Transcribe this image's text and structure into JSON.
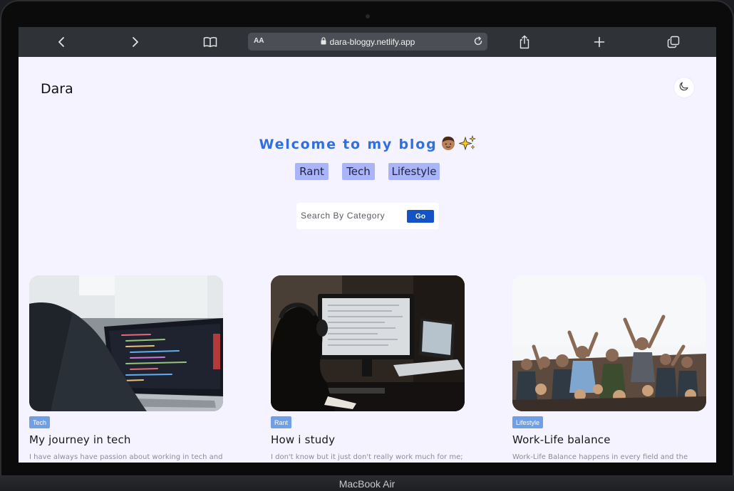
{
  "device": {
    "label": "MacBook Air"
  },
  "browser": {
    "text_size_label": "AA",
    "url": "dara-bloggy.netlify.app",
    "icons": [
      "back-icon",
      "forward-icon",
      "bookmarks-icon",
      "lock-icon",
      "reload-icon",
      "share-icon",
      "new-tab-icon",
      "tabs-icon"
    ]
  },
  "site": {
    "brand": "Dara",
    "theme_toggle_icon": "moon-icon",
    "welcome": "Welcome to my blog",
    "welcome_emojis": [
      "boy-emoji",
      "sparkles-emoji"
    ],
    "categories": [
      "Rant",
      "Tech",
      "Lifestyle"
    ],
    "search": {
      "placeholder": "Search By Category",
      "button": "Go"
    },
    "accent": "#2f6fe0",
    "tag_color": "#a9b5f8"
  },
  "posts": [
    {
      "category": "Tech",
      "title": "My journey in tech",
      "excerpt": "I have always have passion about working in tech and",
      "image": "person-coding-on-laptop-photo"
    },
    {
      "category": "Rant",
      "title": "How i study",
      "excerpt": "I don't know but it just don't really work much for me;",
      "image": "person-studying-at-desk-photo"
    },
    {
      "category": "Lifestyle",
      "title": "Work-Life balance",
      "excerpt": "Work-Life Balance happens in every field and the",
      "image": "crowd-at-festival-photo"
    }
  ]
}
